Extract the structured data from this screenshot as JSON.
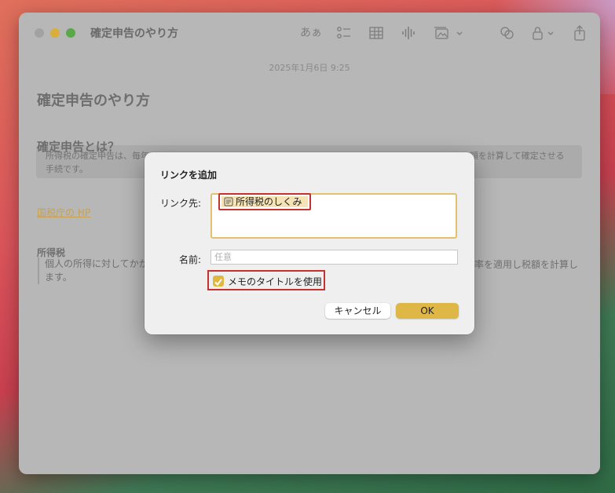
{
  "window": {
    "title": "確定申告のやり方"
  },
  "toolbar": {
    "font_button": "あぁ"
  },
  "note": {
    "date": "2025年1月6日 9:25",
    "title": "確定申告のやり方",
    "heading1": "確定申告とは？",
    "para1_line1": "所得税の確定申告は、毎年",
    "para1_line1_end": "額を計算して確定させる",
    "para1_line2": "手続です。",
    "link_text": "国税庁の HP",
    "heading2": "所得税",
    "para2_line1": "個人の所得に対してかか",
    "para2_line1_end": "率を適用し税額を計算し",
    "para2_line2": "ます。"
  },
  "dialog": {
    "title": "リンクを追加",
    "link_label": "リンク先:",
    "link_chip": "所得税のしくみ",
    "name_label": "名前:",
    "name_placeholder": "任意",
    "use_title_checkbox": "メモのタイトルを使用",
    "cancel_button": "キャンセル",
    "ok_button": "OK"
  },
  "colors": {
    "accent": "#dfb746",
    "highlight_border": "#c6332f"
  }
}
